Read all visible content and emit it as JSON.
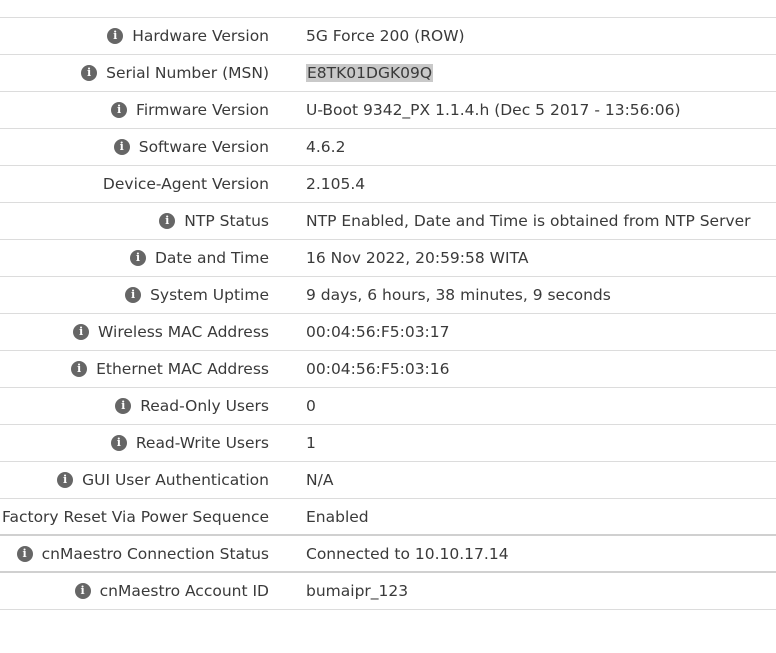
{
  "rows": [
    {
      "label": "Hardware Version",
      "value": "5G Force 200 (ROW)",
      "info": true
    },
    {
      "label": "Serial Number (MSN)",
      "value": "E8TK01DGK09Q",
      "info": true,
      "highlighted": true
    },
    {
      "label": "Firmware Version",
      "value": "U-Boot 9342_PX 1.1.4.h (Dec 5 2017 - 13:56:06)",
      "info": true
    },
    {
      "label": "Software Version",
      "value": "4.6.2",
      "info": true
    },
    {
      "label": "Device-Agent Version",
      "value": "2.105.4",
      "info": false
    },
    {
      "label": "NTP Status",
      "value": "NTP Enabled, Date and Time is obtained from NTP Server",
      "info": true
    },
    {
      "label": "Date and Time",
      "value": "16 Nov 2022, 20:59:58 WITA",
      "info": true
    },
    {
      "label": "System Uptime",
      "value": "9 days, 6 hours, 38 minutes, 9 seconds",
      "info": true
    },
    {
      "label": "Wireless MAC Address",
      "value": "00:04:56:F5:03:17",
      "info": true
    },
    {
      "label": "Ethernet MAC Address",
      "value": "00:04:56:F5:03:16",
      "info": true
    },
    {
      "label": "Read-Only Users",
      "value": "0",
      "info": true
    },
    {
      "label": "Read-Write Users",
      "value": "1",
      "info": true
    },
    {
      "label": "GUI User Authentication",
      "value": "N/A",
      "info": true
    },
    {
      "label": "Factory Reset Via Power Sequence",
      "value": "Enabled",
      "info": true
    },
    {
      "label": "cnMaestro Connection Status",
      "value": "Connected to 10.10.17.14",
      "info": true
    },
    {
      "label": "cnMaestro Account ID",
      "value": "bumaipr_123",
      "info": true
    }
  ],
  "info_icon_glyph": "i",
  "icon_color": "#666666",
  "highlight_color": "#c9c9c9"
}
